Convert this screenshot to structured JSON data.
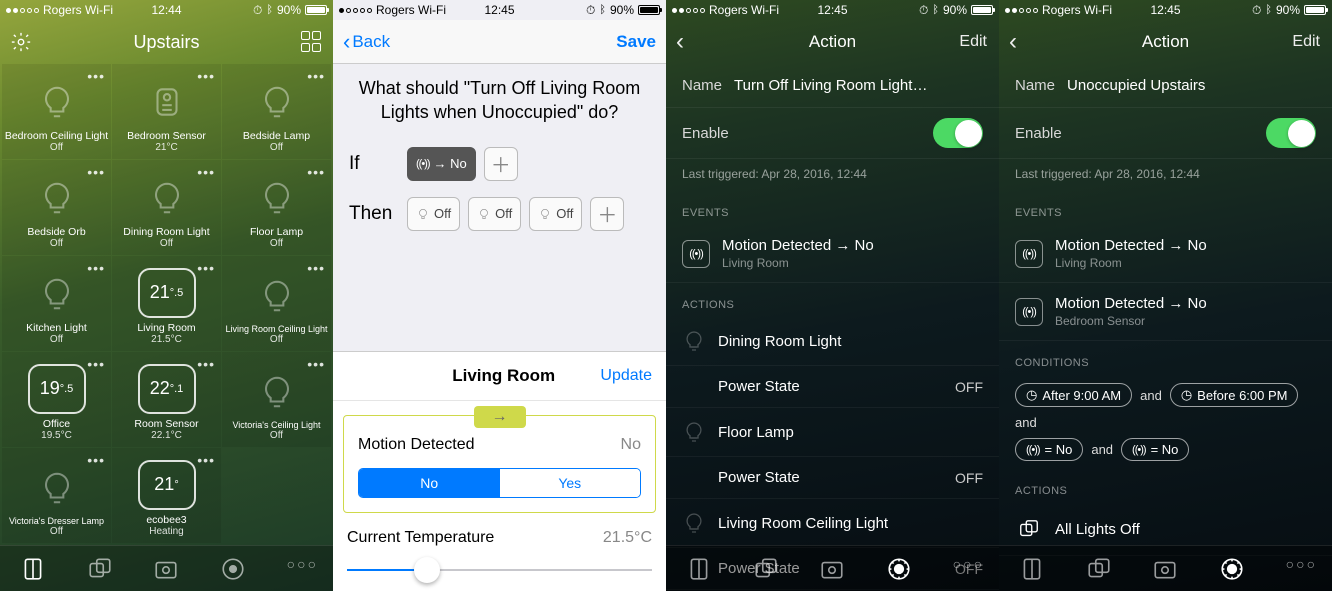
{
  "status": {
    "carrier": "Rogers Wi-Fi",
    "time1": "12:44",
    "time2": "12:45",
    "battery_pct": "90%"
  },
  "s1": {
    "title": "Upstairs",
    "tiles": [
      {
        "name": "Bedroom Ceiling Light",
        "sub": "Off",
        "type": "bulb"
      },
      {
        "name": "Bedroom Sensor",
        "sub": "21°C",
        "type": "sensor"
      },
      {
        "name": "Bedside Lamp",
        "sub": "Off",
        "type": "bulb"
      },
      {
        "name": "Bedside Orb",
        "sub": "Off",
        "type": "bulb"
      },
      {
        "name": "Dining Room Light",
        "sub": "Off",
        "type": "bulb"
      },
      {
        "name": "Floor Lamp",
        "sub": "Off",
        "type": "bulb"
      },
      {
        "name": "Kitchen Light",
        "sub": "Off",
        "type": "bulb"
      },
      {
        "name": "Living Room",
        "sub": "21.5°C",
        "type": "temp",
        "big": "21",
        "dec": ".5"
      },
      {
        "name": "Living Room Ceiling Light",
        "sub": "Off",
        "type": "bulb",
        "small": true
      },
      {
        "name": "Office",
        "sub": "19.5°C",
        "type": "temp",
        "big": "19",
        "dec": ".5"
      },
      {
        "name": "Room Sensor",
        "sub": "22.1°C",
        "type": "temp",
        "big": "22",
        "dec": ".1"
      },
      {
        "name": "Victoria's Ceiling Light",
        "sub": "Off",
        "type": "bulb",
        "small": true
      },
      {
        "name": "Victoria's Dresser Lamp",
        "sub": "Off",
        "type": "bulb",
        "small": true
      },
      {
        "name": "ecobee3",
        "sub": "Heating",
        "type": "temp",
        "big": "21",
        "dec": ""
      }
    ]
  },
  "s2": {
    "back": "Back",
    "save": "Save",
    "question": "What should \"Turn Off Living Room Lights when Unoccupied\" do?",
    "if_label": "If",
    "then_label": "Then",
    "if_chip": "→ No",
    "then_off": "Off",
    "panel_title": "Living Room",
    "update": "Update",
    "motion_label": "Motion Detected",
    "motion_value": "No",
    "seg_no": "No",
    "seg_yes": "Yes",
    "temp_label": "Current Temperature",
    "temp_value": "21.5°C"
  },
  "s3": {
    "title": "Action",
    "edit": "Edit",
    "name_label": "Name",
    "name_value": "Turn Off Living Room Lights when Unoccup…",
    "enable": "Enable",
    "last": "Last triggered: Apr 28, 2016, 12:44",
    "events_h": "EVENTS",
    "event1": "Motion Detected → No",
    "event1_sub": "Living Room",
    "actions_h": "ACTIONS",
    "actions": [
      {
        "name": "Dining Room Light"
      },
      {
        "name": "Power State",
        "val": "OFF",
        "sub": true
      },
      {
        "name": "Floor Lamp"
      },
      {
        "name": "Power State",
        "val": "OFF",
        "sub": true
      },
      {
        "name": "Living Room Ceiling Light"
      },
      {
        "name": "Power State",
        "val": "OFF",
        "sub": true
      }
    ]
  },
  "s4": {
    "title": "Action",
    "edit": "Edit",
    "name_label": "Name",
    "name_value": "Unoccupied Upstairs",
    "enable": "Enable",
    "last": "Last triggered: Apr 28, 2016, 12:44",
    "events_h": "EVENTS",
    "events": [
      {
        "t": "Motion Detected → No",
        "s": "Living Room"
      },
      {
        "t": "Motion Detected → No",
        "s": "Bedroom Sensor"
      }
    ],
    "cond_h": "CONDITIONS",
    "cond_after": "After 9:00 AM",
    "cond_before": "Before 6:00 PM",
    "cond_eq": "= No",
    "cond_and": "and",
    "actions_h": "ACTIONS",
    "scene": "All Lights Off"
  }
}
